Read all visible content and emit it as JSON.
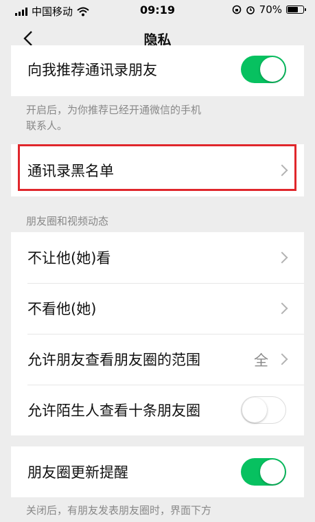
{
  "status": {
    "carrier": "中国移动",
    "time": "09:19",
    "battery": "70%",
    "battery_level": 0.7
  },
  "nav": {
    "title": "隐私"
  },
  "rows": {
    "recommend_contacts": "向我推荐通讯录朋友",
    "blacklist": "通讯录黑名单",
    "not_let_see": "不让他(她)看",
    "not_see": "不看他(她)",
    "moments_range": "允许朋友查看朋友圈的范围",
    "moments_range_value": "全",
    "stranger_ten": "允许陌生人查看十条朋友圈",
    "moments_reminder": "朋友圈更新提醒"
  },
  "toggles": {
    "recommend_contacts": true,
    "stranger_ten": false,
    "moments_reminder": true
  },
  "notes": {
    "recommend_line1": "开启后，为你推荐已经开通微信的手机",
    "recommend_line2": "联系人。",
    "reminder_line1": "关闭后，有朋友发表朋友圈时，界面下方"
  },
  "sections": {
    "moments_title": "朋友圈和视频动态"
  },
  "colors": {
    "accent_green": "#07c160",
    "highlight_red": "#e0262b"
  }
}
